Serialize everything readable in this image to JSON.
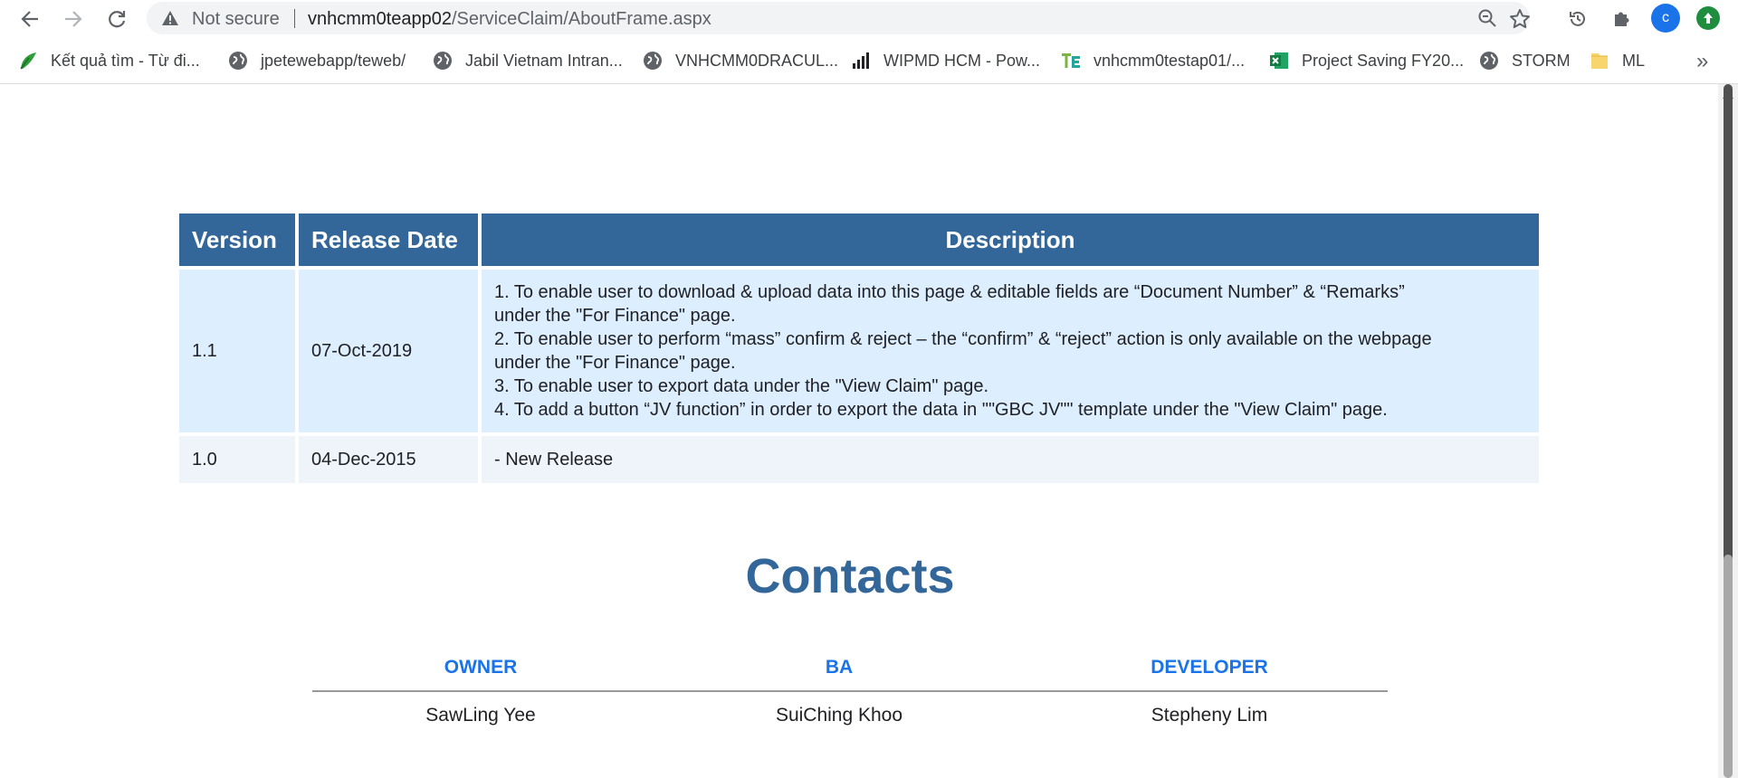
{
  "browser": {
    "security_label": "Not secure",
    "url_host": "vnhcmm0teapp02",
    "url_path": "/ServiceClaim/AboutFrame.aspx",
    "profile_initial": "c",
    "bookmarks": [
      {
        "label": "Kết quả tìm - Từ đi...",
        "icon": "green-leaf-icon"
      },
      {
        "label": "jpetewebapp/teweb/",
        "icon": "globe-icon"
      },
      {
        "label": "Jabil Vietnam Intran...",
        "icon": "globe-icon"
      },
      {
        "label": "VNHCMM0DRACUL...",
        "icon": "globe-icon"
      },
      {
        "label": "WIPMD HCM - Pow...",
        "icon": "bar-chart-icon"
      },
      {
        "label": "vnhcmm0testap01/...",
        "icon": "te-logo-icon"
      },
      {
        "label": "Project Saving FY20...",
        "icon": "excel-icon"
      },
      {
        "label": "STORM",
        "icon": "globe-icon"
      },
      {
        "label": "ML",
        "icon": "folder-icon"
      }
    ],
    "more_label": "»"
  },
  "release_table": {
    "headers": {
      "version": "Version",
      "release_date": "Release Date",
      "description": "Description"
    },
    "rows": [
      {
        "version": "1.1",
        "release_date": "07-Oct-2019",
        "description_lines": [
          "1. To enable user to download & upload data into this page & editable fields are “Document Number” & “Remarks”",
          "under the \"For Finance\" page.",
          "2. To enable user to perform “mass” confirm & reject – the “confirm” & “reject” action is only available on the webpage",
          "under the \"For Finance\" page.",
          "3. To enable user to export data under the \"View Claim\" page.",
          "4. To add a button “JV function” in order to export the data in \"\"GBC JV\"\" template under the \"View Claim\" page."
        ]
      },
      {
        "version": "1.0",
        "release_date": "04-Dec-2015",
        "description_lines": [
          "- New Release"
        ]
      }
    ]
  },
  "contacts": {
    "title": "Contacts",
    "roles": [
      {
        "role": "OWNER",
        "name": "SawLing Yee"
      },
      {
        "role": "BA",
        "name": "SuiChing Khoo"
      },
      {
        "role": "DEVELOPER",
        "name": "Stepheny Lim"
      }
    ]
  },
  "colors": {
    "header_bg": "#336699",
    "row_highlight": "#ddeeff",
    "row_plain": "#eef4fa",
    "contacts_title": "#336699",
    "role_label": "#1a73e8"
  }
}
